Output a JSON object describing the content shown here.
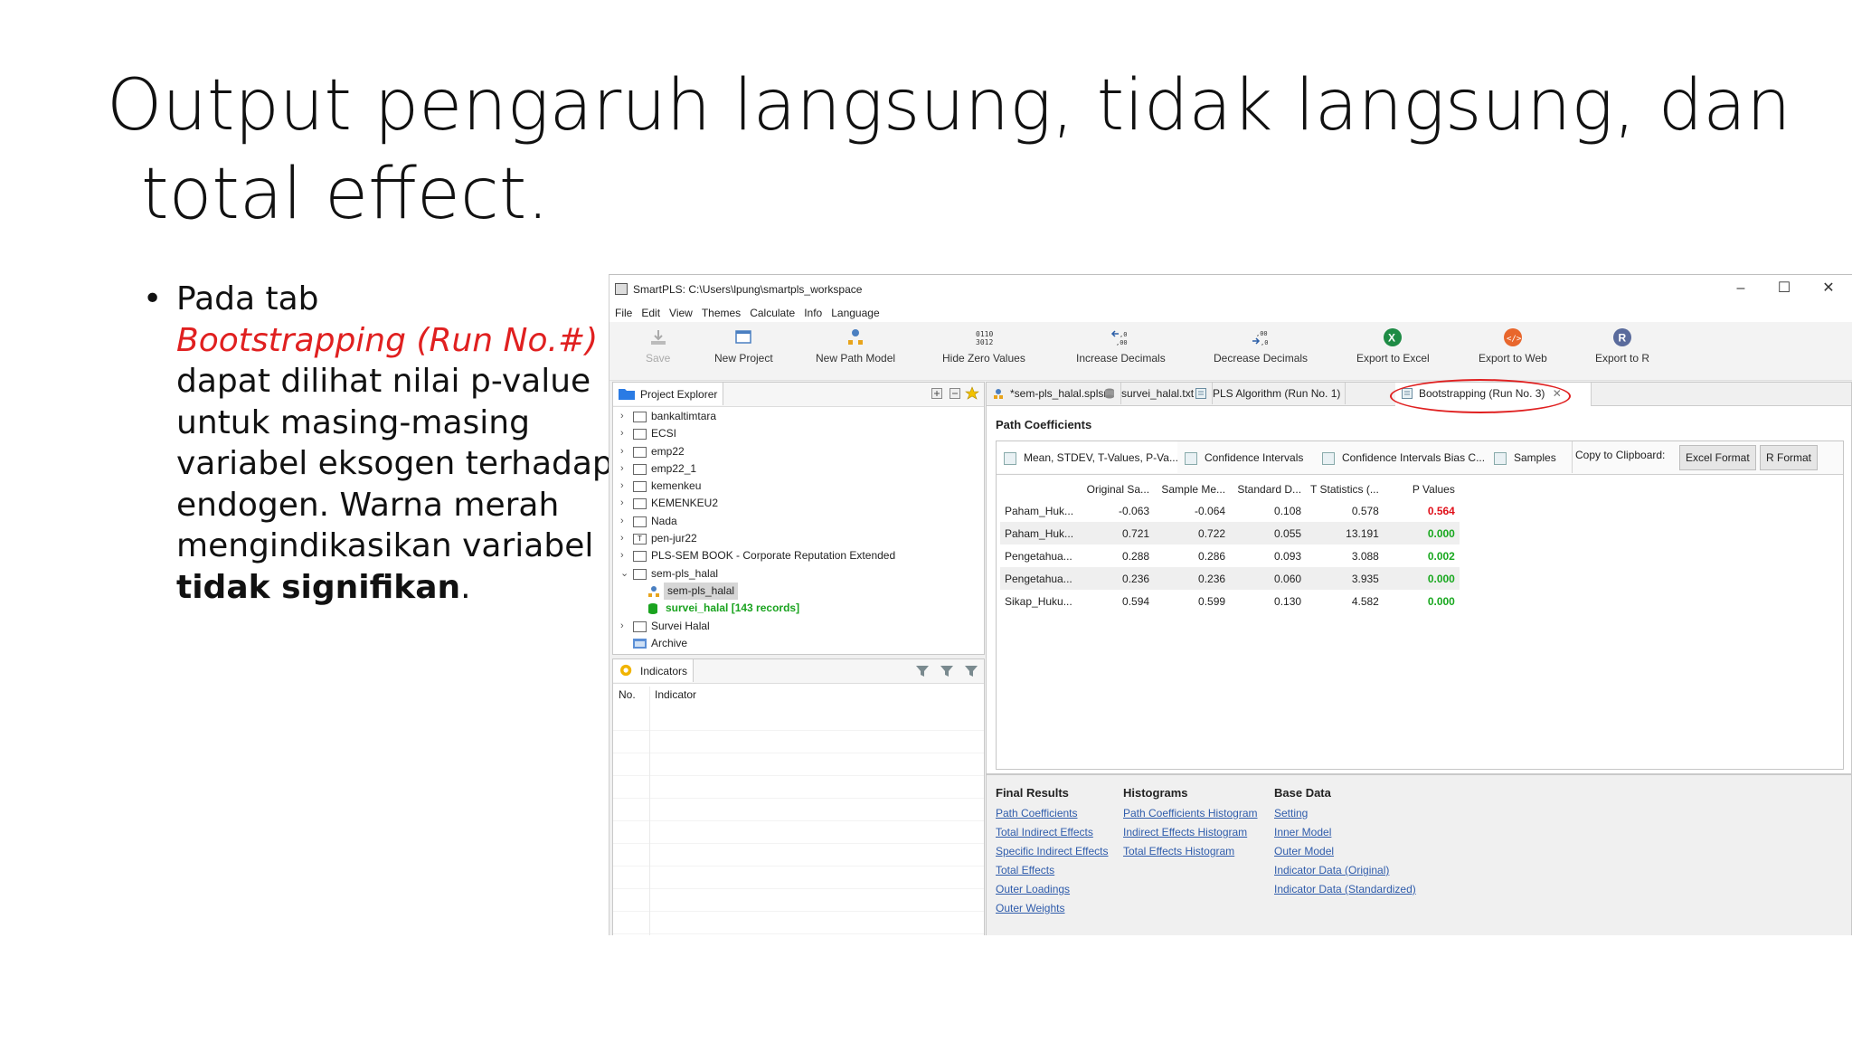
{
  "slide": {
    "title_line1": "Output pengaruh langsung, tidak langsung, dan",
    "title_line2": "total effect.",
    "bullet": {
      "part1": "Pada tab",
      "red": "Bootstrapping (Run No.#)",
      "part2": "dapat dilihat nilai p-value untuk masing-masing variabel eksogen terhadap endogen. Warna merah mengindikasikan variabel",
      "bold": "tidak signifikan",
      "end": "."
    }
  },
  "window": {
    "title": "SmartPLS: C:\\Users\\lpung\\smartpls_workspace"
  },
  "menu": [
    "File",
    "Edit",
    "View",
    "Themes",
    "Calculate",
    "Info",
    "Language"
  ],
  "toolbar": {
    "save": "Save",
    "new_project": "New Project",
    "new_path_model": "New Path Model",
    "hide_zero_values": "Hide Zero Values",
    "increase_decimals": "Increase Decimals",
    "decrease_decimals": "Decrease Decimals",
    "export_excel": "Export to Excel",
    "export_web": "Export to Web",
    "export_r": "Export to R"
  },
  "explorer": {
    "tab_label": "Project Explorer",
    "items": [
      {
        "label": "bankaltimtara"
      },
      {
        "label": "ECSI"
      },
      {
        "label": "emp22"
      },
      {
        "label": "emp22_1"
      },
      {
        "label": "kemenkeu"
      },
      {
        "label": "KEMENKEU2"
      },
      {
        "label": "Nada"
      },
      {
        "label": "pen-jur22"
      },
      {
        "label": "PLS-SEM BOOK - Corporate Reputation Extended"
      },
      {
        "label": "sem-pls_halal"
      },
      {
        "label": "sem-pls_halal"
      },
      {
        "label": "survei_halal [143 records]"
      },
      {
        "label": "Survei Halal"
      },
      {
        "label": "Archive"
      }
    ]
  },
  "indicators": {
    "tab_label": "Indicators",
    "col_no": "No.",
    "col_indicator": "Indicator"
  },
  "editor_tabs": [
    "*sem-pls_halal.splsm",
    "survei_halal.txt",
    "PLS Algorithm (Run No. 1)",
    "Bootstrapping (Run No. 3)"
  ],
  "path_coefficients": {
    "title": "Path Coefficients",
    "sub_tabs": [
      "Mean, STDEV, T-Values, P-Va...",
      "Confidence Intervals",
      "Confidence Intervals Bias C...",
      "Samples"
    ],
    "clipboard_label": "Copy to Clipboard:",
    "excel_format": "Excel Format",
    "r_format": "R Format",
    "headers": [
      "",
      "Original Sa...",
      "Sample Me...",
      "Standard D...",
      "T Statistics (...",
      "P Values"
    ],
    "rows": [
      {
        "name": "Paham_Huk...",
        "original": "-0.063",
        "mean": "-0.064",
        "stdev": "0.108",
        "t": "0.578",
        "p": "0.564",
        "p_color": "#e0101a"
      },
      {
        "name": "Paham_Huk...",
        "original": "0.721",
        "mean": "0.722",
        "stdev": "0.055",
        "t": "13.191",
        "p": "0.000",
        "p_color": "#19a81f"
      },
      {
        "name": "Pengetahua...",
        "original": "0.288",
        "mean": "0.286",
        "stdev": "0.093",
        "t": "3.088",
        "p": "0.002",
        "p_color": "#19a81f"
      },
      {
        "name": "Pengetahua...",
        "original": "0.236",
        "mean": "0.236",
        "stdev": "0.060",
        "t": "3.935",
        "p": "0.000",
        "p_color": "#19a81f"
      },
      {
        "name": "Sikap_Huku...",
        "original": "0.594",
        "mean": "0.599",
        "stdev": "0.130",
        "t": "4.582",
        "p": "0.000",
        "p_color": "#19a81f"
      }
    ]
  },
  "bottom": {
    "final_results": {
      "heading": "Final Results",
      "links": [
        "Path Coefficients",
        "Total Indirect Effects",
        "Specific Indirect Effects",
        "Total Effects",
        "Outer Loadings",
        "Outer Weights"
      ]
    },
    "histograms": {
      "heading": "Histograms",
      "links": [
        "Path Coefficients Histogram",
        "Indirect Effects Histogram",
        "Total Effects Histogram"
      ]
    },
    "base_data": {
      "heading": "Base Data",
      "links": [
        "Setting",
        "Inner Model",
        "Outer Model",
        "Indicator Data (Original)",
        "Indicator Data (Standardized)"
      ]
    }
  },
  "colors": {
    "accent_red": "#e02020",
    "link_blue": "#2f5cab",
    "sig_green": "#19a81f",
    "data_green": "#1aa31f"
  }
}
